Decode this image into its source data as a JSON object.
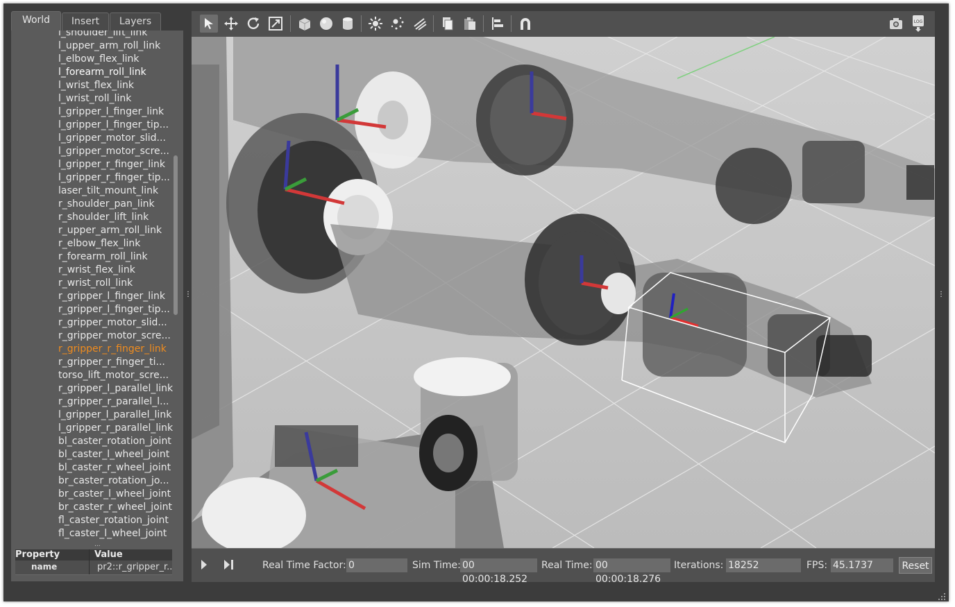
{
  "tabs": [
    "World",
    "Insert",
    "Layers"
  ],
  "tree_items": [
    "l_shoulder_lift_link",
    "l_upper_arm_roll_link",
    "l_elbow_flex_link",
    "l_forearm_roll_link",
    "l_wrist_flex_link",
    "l_wrist_roll_link",
    "l_gripper_l_finger_link",
    "l_gripper_l_finger_tip...",
    "l_gripper_motor_slid...",
    "l_gripper_motor_scre...",
    "l_gripper_r_finger_link",
    "l_gripper_r_finger_tip...",
    "laser_tilt_mount_link",
    "r_shoulder_pan_link",
    "r_shoulder_lift_link",
    "r_upper_arm_roll_link",
    "r_elbow_flex_link",
    "r_forearm_roll_link",
    "r_wrist_flex_link",
    "r_wrist_roll_link",
    "r_gripper_l_finger_link",
    "r_gripper_l_finger_tip...",
    "r_gripper_motor_slid...",
    "r_gripper_motor_scre...",
    "r_gripper_r_finger_link",
    "r_gripper_r_finger_ti...",
    "torso_lift_motor_scre...",
    "r_gripper_l_parallel_link",
    "r_gripper_r_parallel_l...",
    "l_gripper_l_parallel_link",
    "l_gripper_r_parallel_link",
    "bl_caster_rotation_joint",
    "bl_caster_l_wheel_joint",
    "bl_caster_r_wheel_joint",
    "br_caster_rotation_jo...",
    "br_caster_l_wheel_joint",
    "br_caster_r_wheel_joint",
    "fl_caster_rotation_joint",
    "fl_caster_l_wheel_joint"
  ],
  "selected_item": "l_forearm_roll_link",
  "highlighted_item": "r_gripper_r_finger_link",
  "overflow_dots": "...",
  "properties": {
    "header_property": "Property",
    "header_value": "Value",
    "row_name": "name",
    "row_value": "pr2::r_gripper_r..."
  },
  "toolbar_icons": [
    "select-arrow-icon",
    "translate-icon",
    "rotate-icon",
    "scale-icon",
    "box-icon",
    "sphere-icon",
    "cylinder-icon",
    "sun-light-icon",
    "point-light-icon",
    "spot-light-icon",
    "copy-icon",
    "paste-icon",
    "align-icon",
    "magnet-icon",
    "screenshot-icon",
    "log-icon"
  ],
  "log_label": "LOG",
  "bottom_bar": {
    "real_time_factor_label": "Real Time Factor:",
    "real_time_factor": "0",
    "sim_time_label": "Sim Time:",
    "sim_time": "00 00:00:18.252",
    "real_time_label": "Real Time:",
    "real_time": "00 00:00:18.276",
    "iterations_label": "Iterations:",
    "iterations": "18252",
    "fps_label": "FPS:",
    "fps": "45.1737",
    "reset_label": "Reset"
  },
  "colors": {
    "selection_orange": "#f08c1e",
    "panel_bg": "#5b5b5b",
    "viewport_bg": "#c9c9c9"
  }
}
